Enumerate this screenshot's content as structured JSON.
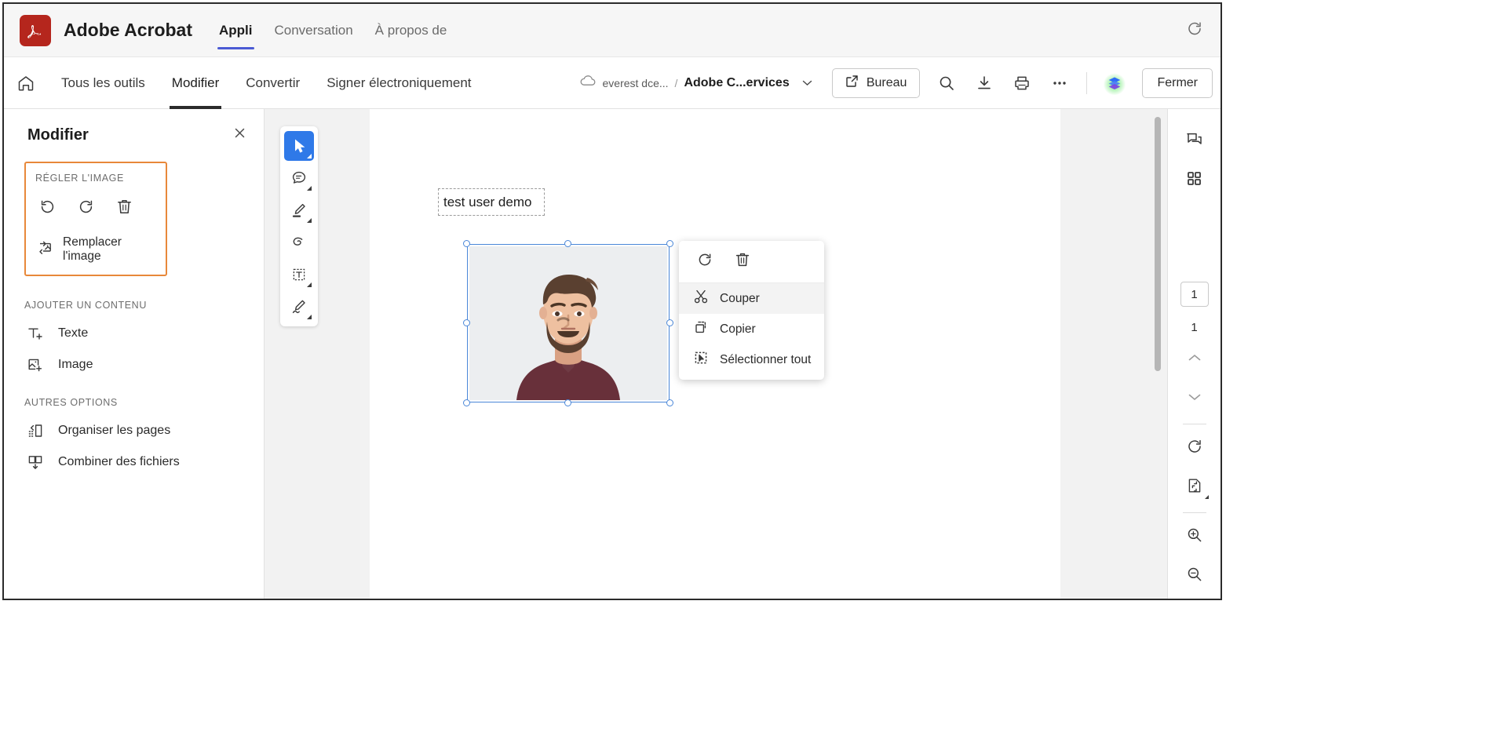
{
  "titlebar": {
    "app_title": "Adobe Acrobat",
    "logo_icon": "acrobat-logo-icon",
    "refresh_icon": "refresh-icon",
    "tabs": [
      {
        "label": "Appli",
        "active": true
      },
      {
        "label": "Conversation",
        "active": false
      },
      {
        "label": "À propos de",
        "active": false
      }
    ]
  },
  "toolbar": {
    "home_icon": "home-icon",
    "tabs": [
      {
        "label": "Tous les outils",
        "active": false
      },
      {
        "label": "Modifier",
        "active": true
      },
      {
        "label": "Convertir",
        "active": false
      },
      {
        "label": "Signer électroniquement",
        "active": false
      }
    ],
    "breadcrumb": {
      "cloud_icon": "cloud-icon",
      "path": "everest dce...",
      "separator": "/",
      "filename": "Adobe C...ervices",
      "caret_icon": "chevron-down-icon"
    },
    "desktop_button": {
      "label": "Bureau",
      "icon": "external-link-icon"
    },
    "icons": [
      {
        "name": "search-icon"
      },
      {
        "name": "download-icon"
      },
      {
        "name": "print-icon"
      },
      {
        "name": "more-options-icon"
      }
    ],
    "avatar": "ai-assistant-avatar",
    "close_button": "Fermer"
  },
  "left_panel": {
    "title": "Modifier",
    "close_icon": "close-icon",
    "adjust_image": {
      "section_label": "RÉGLER L'IMAGE",
      "icons": [
        {
          "name": "rotate-counterclockwise-icon"
        },
        {
          "name": "rotate-clockwise-icon"
        },
        {
          "name": "delete-icon"
        }
      ],
      "replace_label": "Remplacer l'image",
      "replace_icon": "replace-image-icon",
      "highlight_color": "#e8883a"
    },
    "add_content": {
      "section_label": "AJOUTER UN CONTENU",
      "items": [
        {
          "label": "Texte",
          "icon": "add-text-icon"
        },
        {
          "label": "Image",
          "icon": "add-image-icon"
        }
      ]
    },
    "other_options": {
      "section_label": "AUTRES OPTIONS",
      "items": [
        {
          "label": "Organiser les pages",
          "icon": "organize-pages-icon"
        },
        {
          "label": "Combiner des fichiers",
          "icon": "combine-files-icon"
        }
      ]
    }
  },
  "tool_rail": {
    "items": [
      {
        "name": "select-tool",
        "icon": "cursor-icon",
        "active": true,
        "caret": true
      },
      {
        "name": "comment-tool",
        "icon": "comment-bubble-icon",
        "active": false,
        "caret": true
      },
      {
        "name": "highlight-tool",
        "icon": "highlighter-icon",
        "active": false,
        "caret": true
      },
      {
        "name": "draw-tool",
        "icon": "lasso-icon",
        "active": false,
        "caret": false
      },
      {
        "name": "text-box-tool",
        "icon": "text-box-icon",
        "active": false,
        "caret": true
      },
      {
        "name": "signature-tool",
        "icon": "signature-pen-icon",
        "active": false,
        "caret": true
      }
    ]
  },
  "document": {
    "text_object": "test user demo",
    "image_object": "portrait-photo",
    "selection_color": "#4a87d8"
  },
  "context_menu": {
    "top_icons": [
      {
        "name": "rotate-clockwise-icon"
      },
      {
        "name": "delete-icon"
      }
    ],
    "items": [
      {
        "label": "Couper",
        "icon": "scissors-icon",
        "hover": true
      },
      {
        "label": "Copier",
        "icon": "copy-icon",
        "hover": false
      },
      {
        "label": "Sélectionner tout",
        "icon": "select-all-icon",
        "hover": false
      }
    ]
  },
  "right_rail": {
    "top_icons": [
      {
        "name": "comments-panel-icon"
      },
      {
        "name": "thumbnails-grid-icon"
      }
    ],
    "page_number": "1",
    "page_total": "1",
    "nav": [
      {
        "name": "previous-page-icon"
      },
      {
        "name": "next-page-icon"
      }
    ],
    "bottom_icons": [
      {
        "name": "rotate-page-icon"
      },
      {
        "name": "fit-page-icon"
      },
      {
        "name": "zoom-in-icon"
      },
      {
        "name": "zoom-out-icon"
      }
    ]
  }
}
